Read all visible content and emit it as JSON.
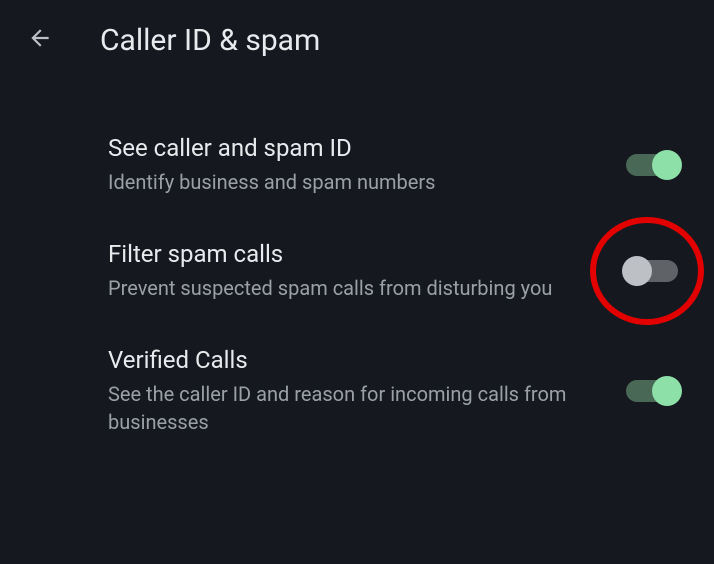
{
  "header": {
    "title": "Caller ID & spam"
  },
  "settings": [
    {
      "title": "See caller and spam ID",
      "description": "Identify business and spam numbers",
      "enabled": true,
      "highlighted": false
    },
    {
      "title": "Filter spam calls",
      "description": "Prevent suspected spam calls from disturbing you",
      "enabled": false,
      "highlighted": true
    },
    {
      "title": "Verified Calls",
      "description": "See the caller ID and reason for incoming calls from businesses",
      "enabled": true,
      "highlighted": false
    }
  ]
}
